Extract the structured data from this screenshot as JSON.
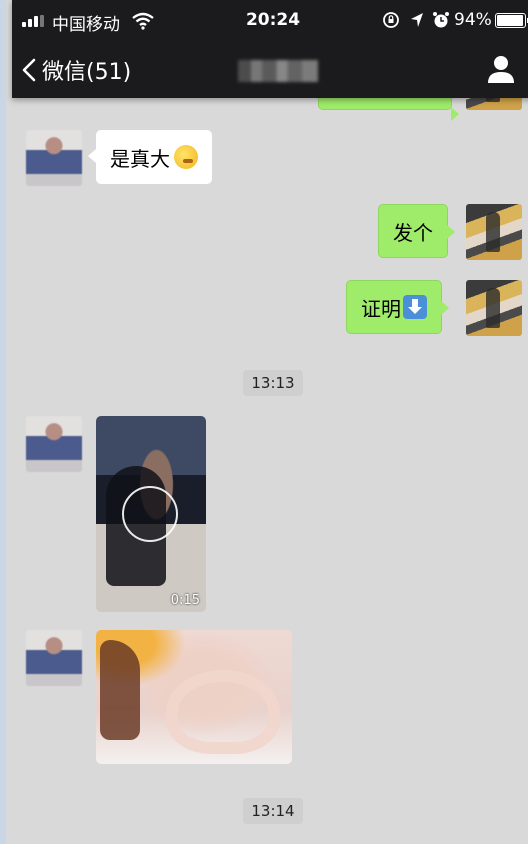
{
  "status_bar": {
    "carrier": "中国移动",
    "time": "20:24",
    "battery_percent": "94%",
    "battery_level": 0.94,
    "icons": [
      "signal-icon",
      "wifi-icon",
      "lock-rotation-icon",
      "location-icon",
      "alarm-icon",
      "battery-icon"
    ]
  },
  "nav": {
    "back_label": "微信(51)",
    "title_blurred": true,
    "profile_icon": "person-icon"
  },
  "messages": [
    {
      "type": "text",
      "direction": "in",
      "text": "是真大",
      "emoji": "thinking-face-emoji"
    },
    {
      "type": "text",
      "direction": "out",
      "text": "发个"
    },
    {
      "type": "text",
      "direction": "out",
      "text": "证明",
      "emoji": "down-arrow-emoji"
    },
    {
      "type": "timestamp",
      "text": "13:13"
    },
    {
      "type": "video",
      "direction": "in",
      "duration": "0:15"
    },
    {
      "type": "image",
      "direction": "in"
    },
    {
      "type": "timestamp",
      "text": "13:14"
    }
  ],
  "colors": {
    "header_bg": "#1b1b1d",
    "chat_bg": "#d9d9d9",
    "outgoing_bubble": "#9feb6a",
    "incoming_bubble": "#ffffff"
  }
}
